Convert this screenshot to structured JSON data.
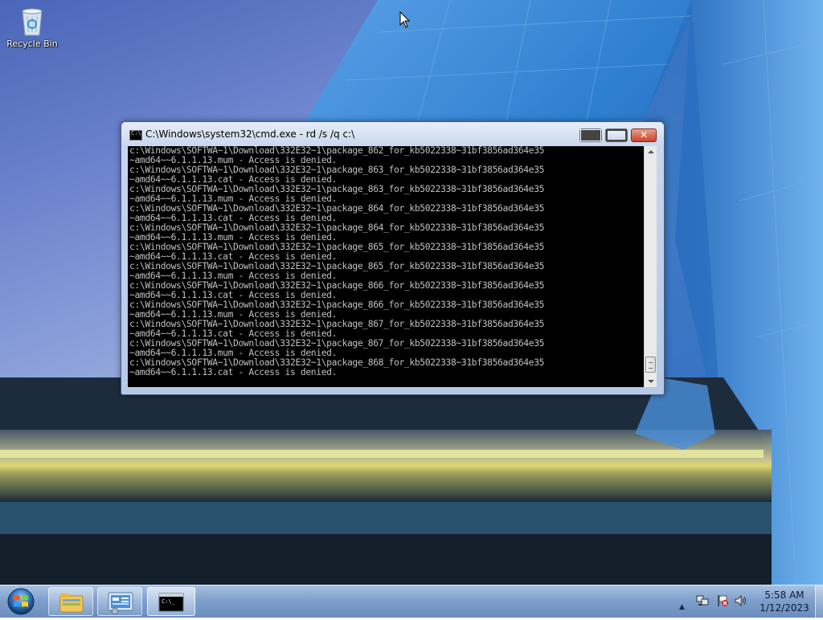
{
  "desktop": {
    "icons": [
      {
        "label": "Recycle Bin",
        "icon": "recycle-bin-icon"
      }
    ]
  },
  "window": {
    "title": "C:\\Windows\\system32\\cmd.exe - rd  /s /q c:\\",
    "icon": "cmd-icon",
    "controls": {
      "minimize": "minimize-icon",
      "maximize": "maximize-icon",
      "close": "close-icon"
    },
    "close_glyph": "✕",
    "console_lines": [
      "c:\\Windows\\SOFTWA~1\\Download\\332E32~1\\package_862_for_kb5022338~31bf3856ad364e35",
      "~amd64~~6.1.1.13.mum - Access is denied.",
      "c:\\Windows\\SOFTWA~1\\Download\\332E32~1\\package_863_for_kb5022338~31bf3856ad364e35",
      "~amd64~~6.1.1.13.cat - Access is denied.",
      "c:\\Windows\\SOFTWA~1\\Download\\332E32~1\\package_863_for_kb5022338~31bf3856ad364e35",
      "~amd64~~6.1.1.13.mum - Access is denied.",
      "c:\\Windows\\SOFTWA~1\\Download\\332E32~1\\package_864_for_kb5022338~31bf3856ad364e35",
      "~amd64~~6.1.1.13.cat - Access is denied.",
      "c:\\Windows\\SOFTWA~1\\Download\\332E32~1\\package_864_for_kb5022338~31bf3856ad364e35",
      "~amd64~~6.1.1.13.mum - Access is denied.",
      "c:\\Windows\\SOFTWA~1\\Download\\332E32~1\\package_865_for_kb5022338~31bf3856ad364e35",
      "~amd64~~6.1.1.13.cat - Access is denied.",
      "c:\\Windows\\SOFTWA~1\\Download\\332E32~1\\package_865_for_kb5022338~31bf3856ad364e35",
      "~amd64~~6.1.1.13.mum - Access is denied.",
      "c:\\Windows\\SOFTWA~1\\Download\\332E32~1\\package_866_for_kb5022338~31bf3856ad364e35",
      "~amd64~~6.1.1.13.cat - Access is denied.",
      "c:\\Windows\\SOFTWA~1\\Download\\332E32~1\\package_866_for_kb5022338~31bf3856ad364e35",
      "~amd64~~6.1.1.13.mum - Access is denied.",
      "c:\\Windows\\SOFTWA~1\\Download\\332E32~1\\package_867_for_kb5022338~31bf3856ad364e35",
      "~amd64~~6.1.1.13.cat - Access is denied.",
      "c:\\Windows\\SOFTWA~1\\Download\\332E32~1\\package_867_for_kb5022338~31bf3856ad364e35",
      "~amd64~~6.1.1.13.mum - Access is denied.",
      "c:\\Windows\\SOFTWA~1\\Download\\332E32~1\\package_868_for_kb5022338~31bf3856ad364e35",
      "~amd64~~6.1.1.13.cat - Access is denied."
    ],
    "console_colors": {
      "background": "#000000",
      "text": "#c0c0c0"
    }
  },
  "taskbar": {
    "start_icon": "windows-start-icon",
    "pinned": [
      {
        "icon": "windows-explorer-icon"
      },
      {
        "icon": "control-panel-icon"
      },
      {
        "icon": "cmd-icon",
        "active": true
      }
    ],
    "tray": {
      "icons": [
        "show-hidden-icons-icon",
        "network-icon",
        "action-center-flag-icon",
        "volume-icon"
      ],
      "arrow_glyph": "▲",
      "time": "5:58 AM",
      "date": "1/12/2023"
    }
  },
  "colors": {
    "taskbar": "#7fa0cc",
    "window_frame": "#c9d8ee",
    "close_button": "#c8422a"
  }
}
